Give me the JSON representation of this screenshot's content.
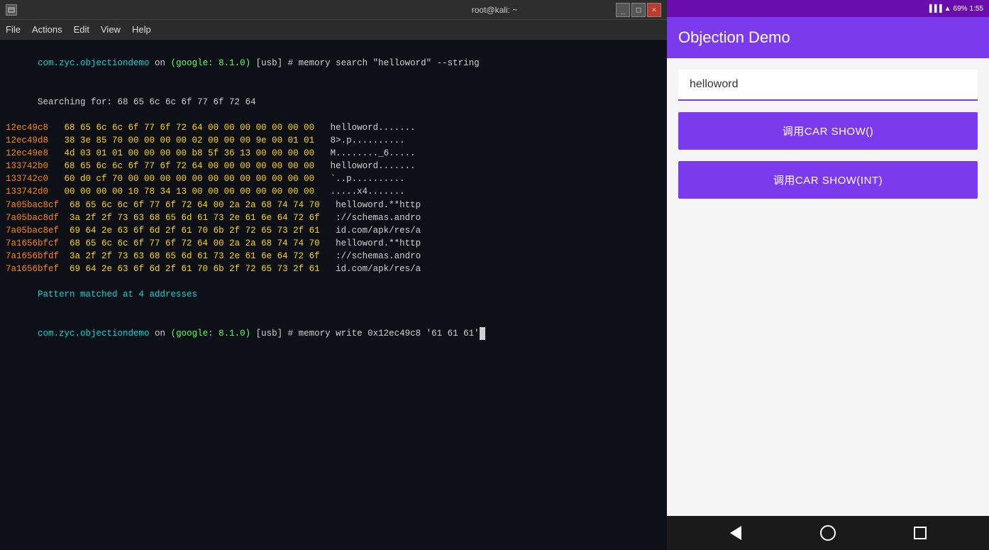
{
  "terminal": {
    "title": "root@kali: ~",
    "menu_items": [
      "File",
      "Actions",
      "Edit",
      "View",
      "Help"
    ],
    "lines": [
      {
        "type": "prompt_cmd",
        "prompt": "com.zyc.objectiondemo on (google: 8.1.0) [usb] #",
        "cmd": " memory search \"helloword\" --string"
      },
      {
        "type": "plain",
        "text": "Searching for: 68 65 6c 6c 6f 77 6f 72 64"
      },
      {
        "type": "memline",
        "addr": "12ec49c8",
        "hex": "68 65 6c 6c 6f 77 6f 72 64 00 00 00 00 00 00 00",
        "ascii": "  helloword......."
      },
      {
        "type": "memline",
        "addr": "12ec49d8",
        "hex": "38 3e 85 70 00 00 00 00 02 00 00 00 9e 00 01 01",
        "ascii": "  8>.p.........."
      },
      {
        "type": "memline",
        "addr": "12ec49e8",
        "hex": "4d 03 01 01 00 00 00 00 b8 5f 36 13 00 00 00 00",
        "ascii": "  M........_6....."
      },
      {
        "type": "memline",
        "addr": "133742b0",
        "hex": "68 65 6c 6c 6f 77 6f 72 64 00 00 00 00 00 00 00",
        "ascii": "  helloword......."
      },
      {
        "type": "memline",
        "addr": "133742c0",
        "hex": "60 d0 cf 70 00 00 00 00 00 00 00 00 00 00 00 00",
        "ascii": "  `..p.........."
      },
      {
        "type": "memline",
        "addr": "133742d0",
        "hex": "00 00 00 00 10 78 34 13 00 00 00 00 00 00 00 00",
        "ascii": "  .....x4......."
      },
      {
        "type": "memline",
        "addr": "7a05bac8cf",
        "hex": "68 65 6c 6c 6f 77 6f 72 64 00 2a 2a 68 74 74 70",
        "ascii": "  helloword.**http"
      },
      {
        "type": "memline",
        "addr": "7a05bac8df",
        "hex": "3a 2f 2f 73 63 68 65 6d 61 73 2e 61 6e 64 72 6f",
        "ascii": "  ://schemas.andro"
      },
      {
        "type": "memline",
        "addr": "7a05bac8ef",
        "hex": "69 64 2e 63 6f 6d 2f 61 70 6b 2f 72 65 73 2f 61",
        "ascii": "  id.com/apk/res/a"
      },
      {
        "type": "memline",
        "addr": "7a1656bfcf",
        "hex": "68 65 6c 6c 6f 77 6f 72 64 00 2a 2a 68 74 74 70",
        "ascii": "  helloword.**http"
      },
      {
        "type": "memline",
        "addr": "7a1656bfdf",
        "hex": "3a 2f 2f 73 63 68 65 6d 61 73 2e 61 6e 64 72 6f",
        "ascii": "  ://schemas.andro"
      },
      {
        "type": "memline",
        "addr": "7a1656bfef",
        "hex": "69 64 2e 63 6f 6d 2f 61 70 6b 2f 72 65 73 2f 61",
        "ascii": "  id.com/apk/res/a"
      },
      {
        "type": "pattern",
        "text": "Pattern matched at 4 addresses"
      },
      {
        "type": "prompt_cmd_cursor",
        "prompt": "com.zyc.objectiondemo on (google: 8.1.0) [usb] #",
        "cmd": " memory write 0x12ec49c8 '61 61 61'",
        "cursor": true
      }
    ]
  },
  "android": {
    "app_title": "Objection Demo",
    "text_display": "helloword",
    "buttons": [
      {
        "label": "调用CAR SHOW()"
      },
      {
        "label": "调用CAR SHOW(INT)"
      }
    ],
    "statusbar": {
      "battery": "69%",
      "time": "1:55"
    },
    "navbar": {
      "back_icon": "◀",
      "home_icon": "○",
      "recent_icon": "□"
    }
  }
}
